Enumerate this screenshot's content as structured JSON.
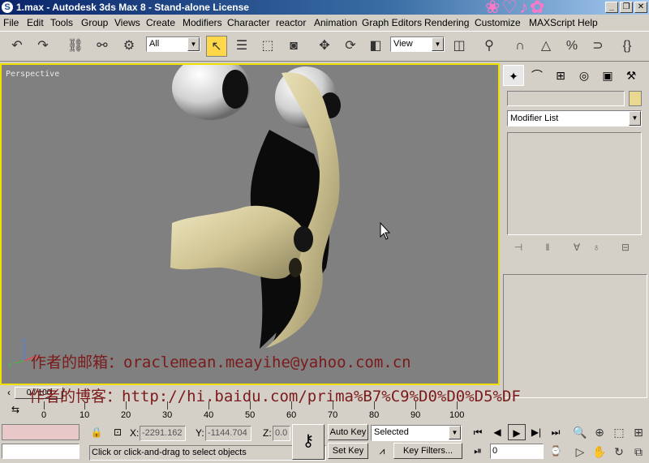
{
  "window": {
    "title": "1.max - Autodesk 3ds Max 8  - Stand-alone License",
    "icon": "3ds-max-icon",
    "buttons": [
      "_",
      "❐",
      "✕"
    ]
  },
  "menu": [
    "File",
    "Edit",
    "Tools",
    "Group",
    "Views",
    "Create",
    "Modifiers",
    "Character",
    "reactor",
    "Animation",
    "Graph Editors",
    "Rendering",
    "Customize",
    "MAXScript",
    "Help"
  ],
  "toolbar": {
    "selection_filter": "All",
    "ref_coord": "View"
  },
  "viewport": {
    "label": "Perspective",
    "border_color": "#f0e000",
    "background": "#808080"
  },
  "watermark": {
    "line1": "作者的邮箱：oraclemean.meayihe@yahoo.com.cn",
    "line2": "作者的博客：http://hi.baidu.com/prima%B7%C9%D0%D0%D5%DF"
  },
  "command_panel": {
    "name_value": "",
    "modifier_list": "Modifier List"
  },
  "timeline": {
    "frame_slider": "0 / 100",
    "ticks": [
      "0",
      "10",
      "20",
      "30",
      "40",
      "50",
      "60",
      "70",
      "80",
      "90",
      "100"
    ]
  },
  "status": {
    "x_label": "X:",
    "x_value": "-2291.162",
    "y_label": "Y:",
    "y_value": "-1144.704",
    "z_label": "Z:",
    "z_value": "0.0",
    "auto_key": "Auto Key",
    "set_key": "Set Key",
    "key_mode": "Selected",
    "key_filters": "Key Filters...",
    "current_frame": "0",
    "prompt": "Click or click-and-drag to select objects"
  }
}
